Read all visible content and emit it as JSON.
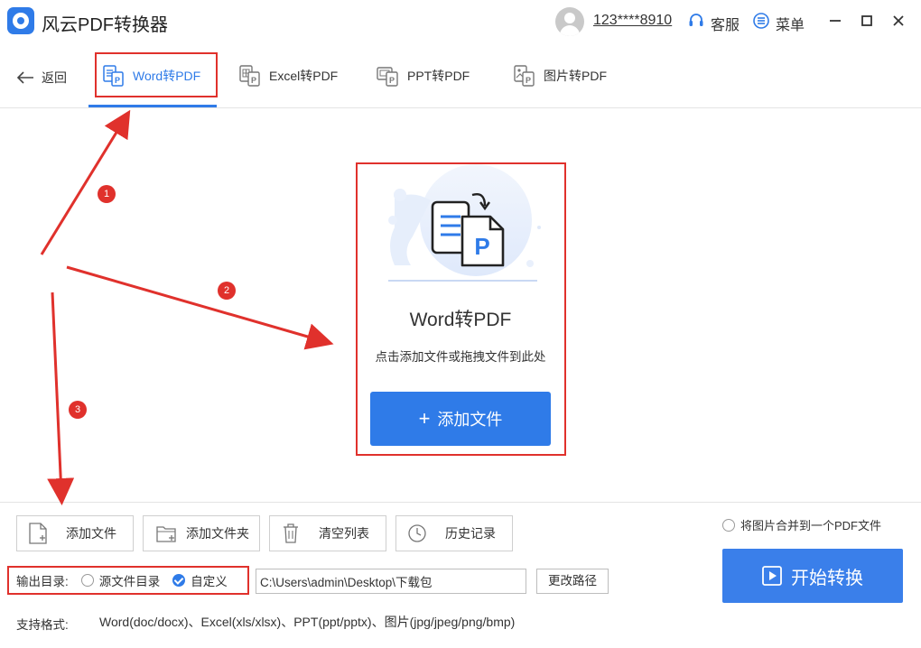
{
  "app": {
    "title": "风云PDF转换器",
    "account": "123****8910",
    "service_label": "客服",
    "menu_label": "菜单"
  },
  "nav": {
    "back_label": "返回",
    "tabs": [
      {
        "label": "Word转PDF",
        "active": true
      },
      {
        "label": "Excel转PDF",
        "active": false
      },
      {
        "label": "PPT转PDF",
        "active": false
      },
      {
        "label": "图片转PDF",
        "active": false
      }
    ]
  },
  "drop_area": {
    "title": "Word转PDF",
    "hint": "点击添加文件或拖拽文件到此处",
    "add_button": "添加文件"
  },
  "toolbar": {
    "add_file": "添加文件",
    "add_folder": "添加文件夹",
    "clear_list": "清空列表",
    "history": "历史记录"
  },
  "merge_option": "将图片合并到一个PDF文件",
  "output": {
    "label": "输出目录:",
    "option_source": "源文件目录",
    "option_custom": "自定义",
    "selected": "自定义",
    "path": "C:\\Users\\admin\\Desktop\\下载包",
    "change_path": "更改路径"
  },
  "formats": {
    "label": "支持格式:",
    "value": "Word(doc/docx)、Excel(xls/xlsx)、PPT(ppt/pptx)、图片(jpg/jpeg/png/bmp)"
  },
  "start_button": "开始转换",
  "annotations": [
    "1",
    "2",
    "3"
  ],
  "colors": {
    "accent": "#2f7be8",
    "annotation_red": "#e0312c"
  }
}
